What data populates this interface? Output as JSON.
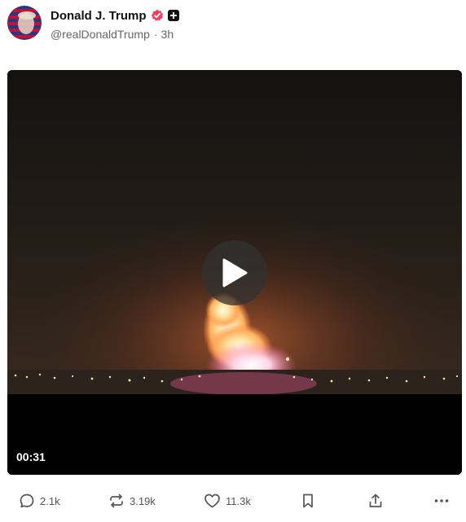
{
  "author": {
    "display_name": "Donald J. Trump",
    "handle": "@realDonaldTrump",
    "separator": "·",
    "time_ago": "3h",
    "verified_color": "#f43f5e"
  },
  "media": {
    "type": "video",
    "duration": "00:31"
  },
  "actions": {
    "reply": {
      "icon": "reply-icon",
      "count": "2.1k"
    },
    "repost": {
      "icon": "repost-icon",
      "count": "3.19k"
    },
    "like": {
      "icon": "heart-icon",
      "count": "11.3k"
    },
    "bookmark": {
      "icon": "bookmark-icon"
    },
    "share": {
      "icon": "share-icon"
    },
    "more": {
      "icon": "more-icon"
    }
  }
}
